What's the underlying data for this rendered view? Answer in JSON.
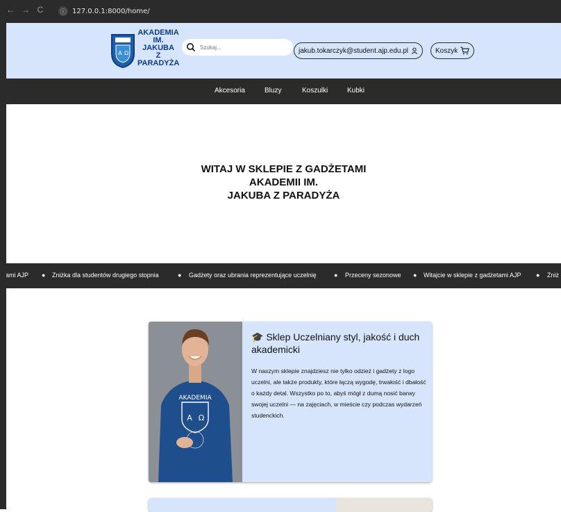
{
  "browser": {
    "url": "127.0.0.1:8000/home/",
    "back_icon": "←",
    "forward_icon": "→",
    "reload_icon": "C"
  },
  "header": {
    "brand_lines": [
      "AKADEMIA",
      "IM.",
      "JAKUBA",
      "Z",
      "PARADYŻA"
    ],
    "search_placeholder": "Szukaj...",
    "user_email": "jakub.tokarczyk@student.ajp.edu.pl",
    "cart_label": "Koszyk"
  },
  "nav": {
    "items": [
      "Akcesoria",
      "Bluzy",
      "Koszulki",
      "Kubki"
    ]
  },
  "hero": {
    "title_lines": [
      "WITAJ W SKLEPIE Z GADŻETAMI",
      "AKADEMII IM.",
      "JAKUBA Z PARADYŻA"
    ]
  },
  "ticker": {
    "items": [
      "ami AJP",
      "Zniżka dla studentów drugiego stopnia",
      "Gadżety oraz ubrania reprezentujące uczelnię",
      "Przeceny sezonowe",
      "Witajcie w sklepie z gadżetami AJP",
      "Zniż"
    ],
    "separator": "●"
  },
  "card": {
    "icon": "🎓",
    "title": "Sklep Uczelniany styl, jakość i duch akademicki",
    "text": "W naszym sklepie znajdziesz nie tylko odzież i gadżety z logo uczelni, ale także produkty, które łączą wygodę, trwałość i dbałość o każdy detal. Wszystko po to, abyś mógł z dumą nosić barwy swojej uczelni — na zajęciach, w mieście czy podczas wydarzeń studenckich.",
    "hoodie_text": "AKADEMIA"
  },
  "colors": {
    "accent": "#d6e5fb",
    "dark": "#2b2b2b",
    "brand": "#0c3b8c",
    "hoodie": "#1f4e8c"
  }
}
